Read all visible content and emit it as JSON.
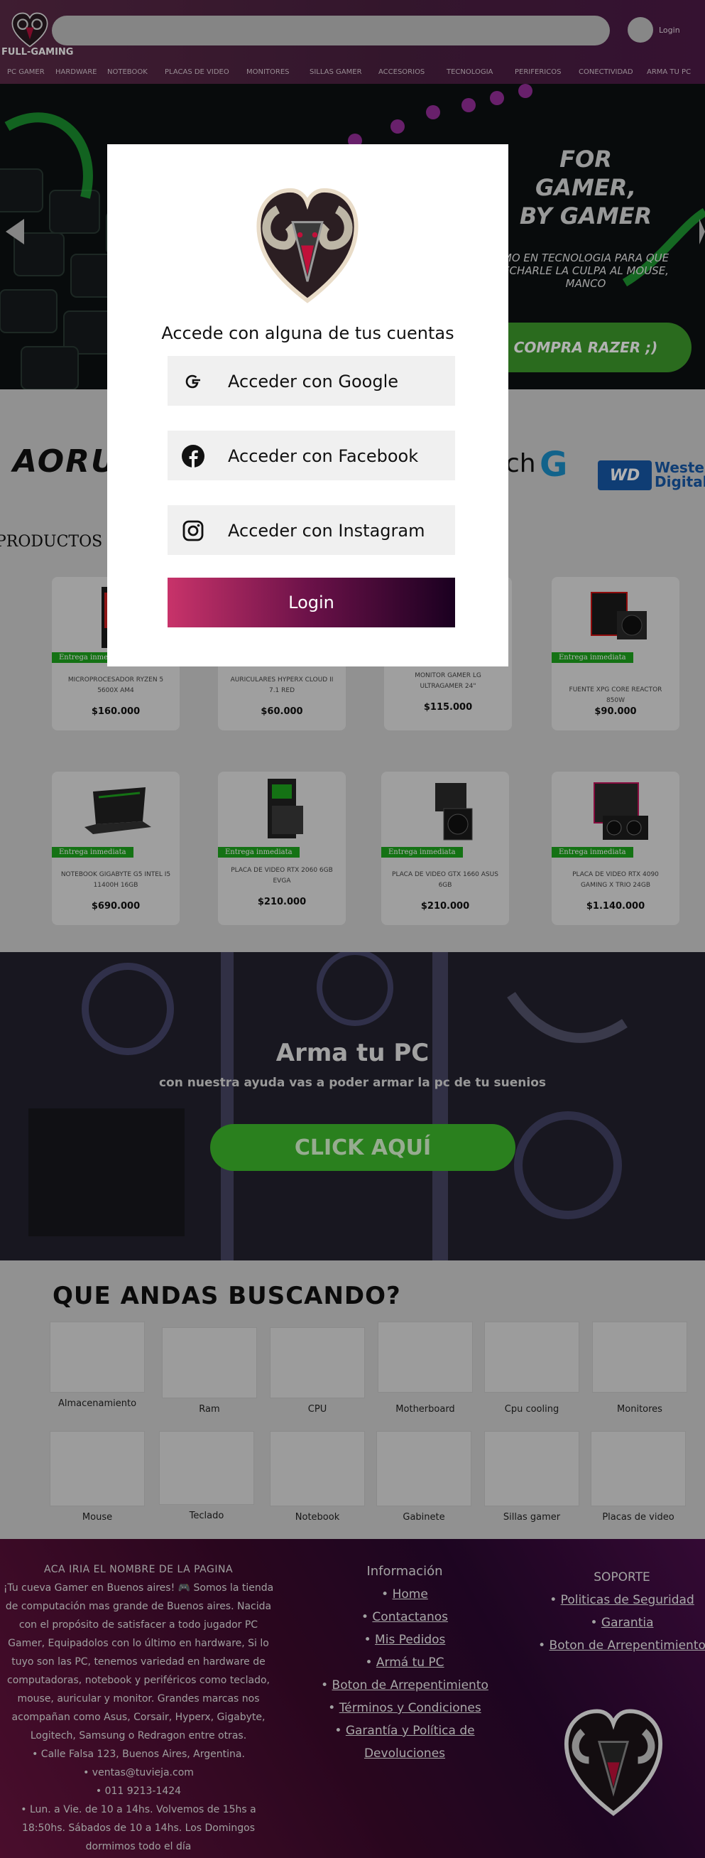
{
  "header": {
    "brand": "FULL-GAMING",
    "search_placeholder": "",
    "login_label": "Login",
    "nav": [
      "PC GAMER",
      "HARDWARE",
      "NOTEBOOK",
      "PLACAS DE VIDEO",
      "MONITORES",
      "SILLAS GAMER",
      "ACCESORIOS",
      "TECNOLOGIA",
      "PERIFERICOS",
      "CONECTIVIDAD",
      "ARMA TU PC"
    ]
  },
  "hero": {
    "title_lines": [
      "FOR",
      "GAMER,",
      "BY GAMER"
    ],
    "subtitle": "MO EN TECNOLOGIA PARA QUE ECHARLE LA CULPA AL MOUSE, MANCO",
    "cta": "COMPRA RAZER ;)"
  },
  "brands": {
    "aorus": "AORUS",
    "logitech": "ch",
    "wd_mark": "WD",
    "wd_text": [
      "Wester",
      "Digital"
    ]
  },
  "products": {
    "heading": "PRODUCTOS D",
    "ribbon": "Entrega inmediata",
    "items": [
      {
        "name": "MICROPROCESADOR RYZEN 5 5600X AM4",
        "price": "$160.000"
      },
      {
        "name": "AURICULARES HYPERX CLOUD II 7.1 RED",
        "price": "$60.000"
      },
      {
        "name": "MONITOR GAMER LG ULTRAGAMER 24\"",
        "price": "$115.000"
      },
      {
        "name": "FUENTE XPG CORE REACTOR 850W",
        "price": "$90.000"
      },
      {
        "name": "NOTEBOOK GIGABYTE G5 INTEL I5 11400H 16GB",
        "price": "$690.000"
      },
      {
        "name": "PLACA DE VIDEO RTX 2060 6GB EVGA",
        "price": "$210.000"
      },
      {
        "name": "PLACA DE VIDEO GTX 1660 ASUS 6GB",
        "price": "$210.000"
      },
      {
        "name": "PLACA DE VIDEO RTX 4090 GAMING X TRIO 24GB",
        "price": "$1.140.000"
      }
    ]
  },
  "build": {
    "title": "Arma tu PC",
    "subtitle": "con nuestra ayuda vas a poder armar la pc de tu suenios",
    "cta": "CLICK AQUÍ"
  },
  "categories": {
    "title": "QUE ANDAS BUSCANDO?",
    "items": [
      "Almacenamiento",
      "Ram",
      "CPU",
      "Motherboard",
      "Cpu cooling",
      "Monitores",
      "Mouse",
      "Teclado",
      "Notebook",
      "Gabinete",
      "Sillas gamer",
      "Placas de video"
    ]
  },
  "footer": {
    "col1_title": "ACA IRIA EL NOMBRE DE LA PAGINA",
    "col1_text": "¡Tu cueva Gamer en Buenos aires! 🎮 Somos la tienda de computación mas grande de Buenos aires. Nacida con el propósito de satisfacer a todo jugador PC Gamer, Equipadolos con lo último en hardware, Si lo tuyo son las PC, tenemos variedad en hardware de computadoras, notebook y periféricos como teclado, mouse, auricular y monitor. Grandes marcas nos acompañan como Asus, Corsair, Hyperx, Gigabyte, Logitech, Samsung o Redragon entre otras.",
    "address": "Calle Falsa 123, Buenos Aires, Argentina.",
    "email": "ventas@tuvieja.com",
    "phone": "011 9213-1424",
    "hours": "Lun. a Vie. de 10 a 14hs. Volvemos de 15hs a 18:50hs. Sábados de 10 a 14hs. Los Domingos dormimos todo el día",
    "info_title": "Información",
    "info_links": [
      "Home",
      "Contactanos",
      "Mis Pedidos",
      "Armá tu PC",
      "Boton de Arrepentimiento",
      "Términos y Condiciones",
      "Garantía y Política de Devoluciones"
    ],
    "support_title": "SOPORTE",
    "support_links": [
      "Politicas de Seguridad",
      "Garantia",
      "Boton de Arrepentimiento"
    ]
  },
  "modal": {
    "title": "Accede con alguna de tus cuentas",
    "google": "Acceder con Google",
    "facebook": "Acceder con Facebook",
    "instagram": "Acceder con Instagram",
    "login": "Login"
  },
  "colors": {
    "header_bg": "#4a2040",
    "accent_green": "#3d9a2b",
    "ribbon_green": "#1ea41e",
    "login_gradient_start": "#c8336a",
    "login_gradient_end": "#1a0020",
    "footer_bg": "#3c0a2c"
  }
}
